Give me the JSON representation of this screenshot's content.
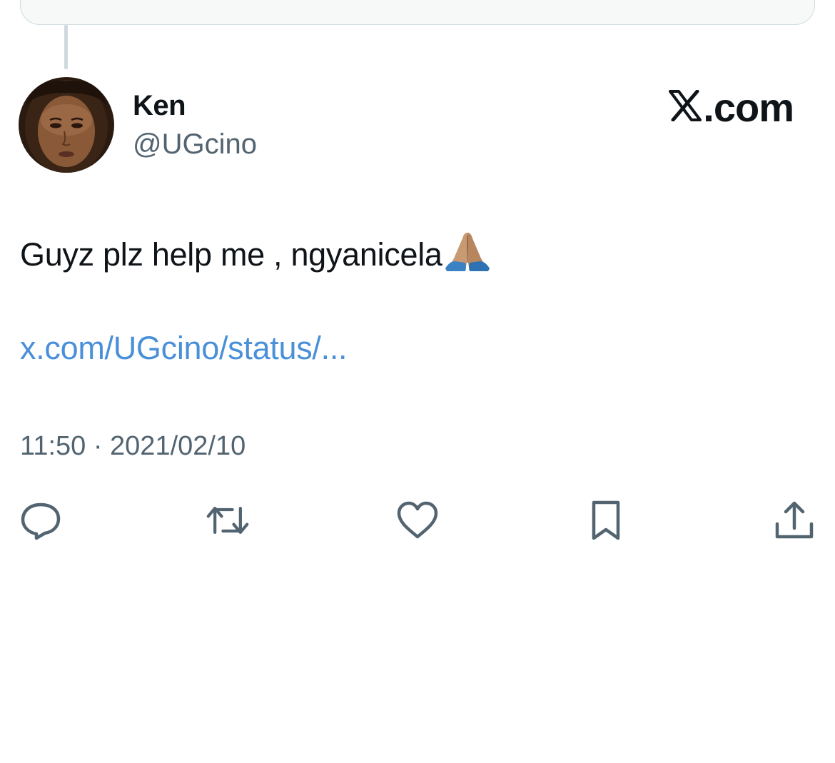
{
  "tweet": {
    "author": {
      "display_name": "Ken",
      "handle": "@UGcino",
      "avatar_icon": "avatar-photo"
    },
    "brand_label": ".com",
    "text": "Guyz plz help me , ngyanicela",
    "emoji": "folded-hands-emoji",
    "link_text": "x.com/UGcino/status/...",
    "timestamp": "11:50 · 2021/02/10"
  },
  "actions": [
    {
      "name": "reply",
      "icon": "reply-icon"
    },
    {
      "name": "repost",
      "icon": "repost-icon"
    },
    {
      "name": "like",
      "icon": "heart-icon"
    },
    {
      "name": "bookmark",
      "icon": "bookmark-icon"
    },
    {
      "name": "share",
      "icon": "share-icon"
    }
  ],
  "colors": {
    "text": "#0f1419",
    "secondary": "#536471",
    "link": "#4a90d9",
    "border": "#cfd9de"
  }
}
